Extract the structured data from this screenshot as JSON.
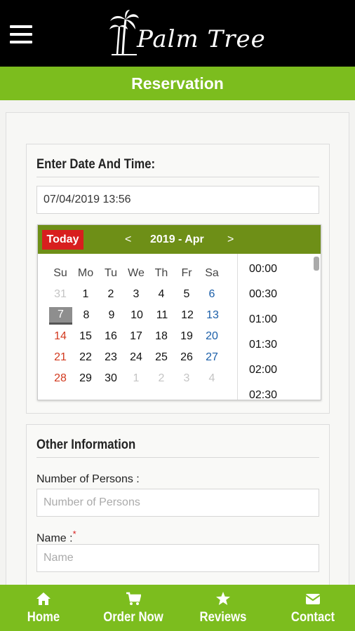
{
  "header": {
    "logo_text": "Palm Tree",
    "menu_icon": "hamburger-menu-icon",
    "logo_icon": "palm-tree-icon"
  },
  "page_title": "Reservation",
  "date_section": {
    "title": "Enter Date And Time:",
    "datetime_value": "07/04/2019 13:56"
  },
  "picker": {
    "today_label": "Today",
    "prev": "<",
    "next": ">",
    "month_label": "2019 - Apr",
    "weekdays": [
      "Su",
      "Mo",
      "Tu",
      "We",
      "Th",
      "Fr",
      "Sa"
    ],
    "weeks": [
      [
        "31",
        "1",
        "2",
        "3",
        "4",
        "5",
        "6"
      ],
      [
        "7",
        "8",
        "9",
        "10",
        "11",
        "12",
        "13"
      ],
      [
        "14",
        "15",
        "16",
        "17",
        "18",
        "19",
        "20"
      ],
      [
        "21",
        "22",
        "23",
        "24",
        "25",
        "26",
        "27"
      ],
      [
        "28",
        "29",
        "30",
        "1",
        "2",
        "3",
        "4"
      ]
    ],
    "selected_day": "7",
    "times": [
      "00:00",
      "00:30",
      "01:00",
      "01:30",
      "02:00",
      "02:30"
    ]
  },
  "other_section": {
    "title": "Other Information",
    "persons_label": "Number of Persons :",
    "persons_placeholder": "Number of Persons",
    "name_label": "Name :",
    "name_required_mark": "*",
    "name_placeholder": "Name"
  },
  "bottom_nav": [
    {
      "label": "Home",
      "icon": "home-icon"
    },
    {
      "label": "Order Now",
      "icon": "cart-icon"
    },
    {
      "label": "Reviews",
      "icon": "star-icon"
    },
    {
      "label": "Contact",
      "icon": "envelope-icon"
    }
  ],
  "colors": {
    "brand_green": "#7cbd1e",
    "picker_header": "#6e8f17",
    "today_red": "#d81e1e",
    "weekend_sun": "#d2391e",
    "weekend_sat": "#1a5ea8"
  }
}
